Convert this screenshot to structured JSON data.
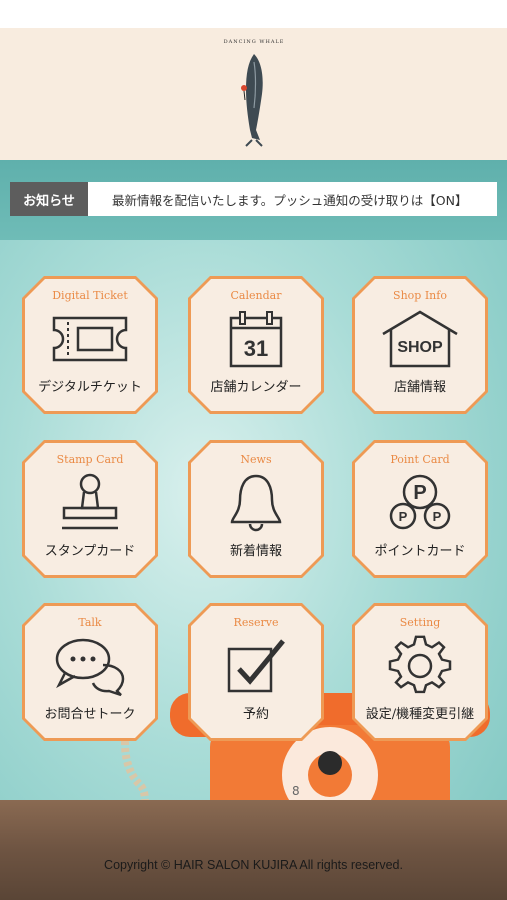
{
  "header": {
    "logo_text": "DANCING WHALE"
  },
  "notice": {
    "label": "お知らせ",
    "text": "最新情報を配信いたします。プッシュ通知の受け取りは【ON】"
  },
  "menu": [
    {
      "en": "Digital Ticket",
      "jp": "デジタルチケット",
      "icon": "ticket-icon"
    },
    {
      "en": "Calendar",
      "jp": "店舗カレンダー",
      "icon": "calendar-icon",
      "icon_text": "31"
    },
    {
      "en": "Shop Info",
      "jp": "店舗情報",
      "icon": "shop-icon",
      "icon_text": "SHOP"
    },
    {
      "en": "Stamp Card",
      "jp": "スタンプカード",
      "icon": "stamp-icon"
    },
    {
      "en": "News",
      "jp": "新着情報",
      "icon": "bell-icon"
    },
    {
      "en": "Point Card",
      "jp": "ポイントカード",
      "icon": "points-icon",
      "icon_text": "P"
    },
    {
      "en": "Talk",
      "jp": "お問合せトーク",
      "icon": "chat-icon"
    },
    {
      "en": "Reserve",
      "jp": "予約",
      "icon": "checkbox-icon"
    },
    {
      "en": "Setting",
      "jp": "設定/機種変更引継",
      "icon": "gear-icon"
    }
  ],
  "footer": {
    "copyright": "Copyright © HAIR SALON KUJIRA All rights reserved."
  },
  "colors": {
    "accent": "#ee9a55",
    "tile_bg": "#f8ede2",
    "header_bg": "#f8ecdf",
    "teal": "#7cc5c0"
  }
}
